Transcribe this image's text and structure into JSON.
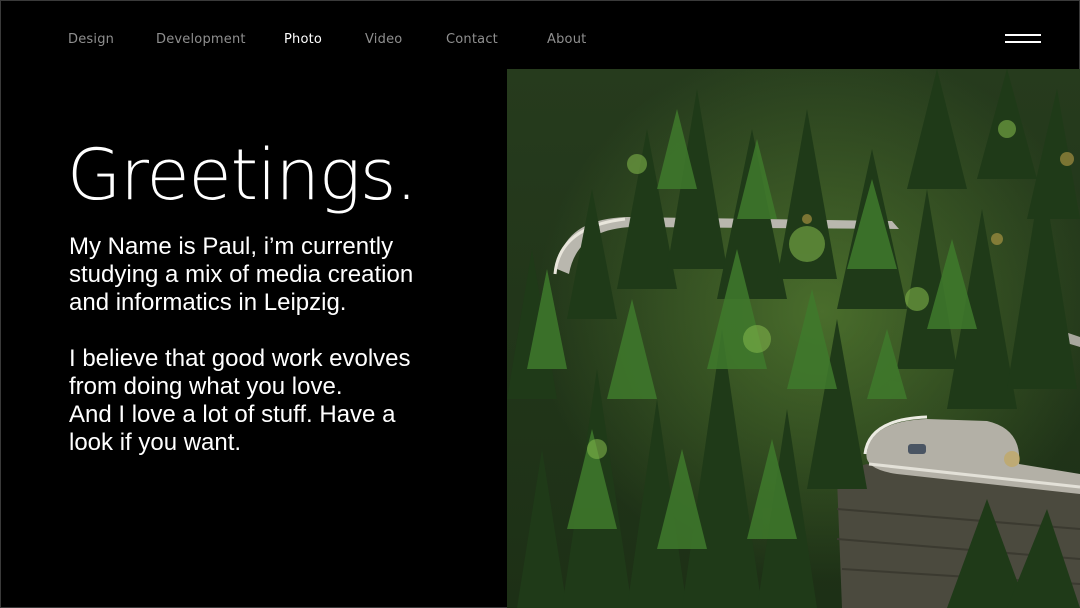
{
  "nav": {
    "items": [
      {
        "label": "Design",
        "active": false
      },
      {
        "label": "Development",
        "active": false
      },
      {
        "label": "Photo",
        "active": true
      },
      {
        "label": "Video",
        "active": false
      },
      {
        "label": "Contact",
        "active": false
      },
      {
        "label": "About",
        "active": false
      }
    ],
    "menu_icon": "hamburger-menu-icon"
  },
  "hero": {
    "headline": "Greetings.",
    "paragraph_1": "My Name is Paul, i’m currently\nstudying a mix of media creation\nand informatics in Leipzig.",
    "paragraph_2": "I believe that good work evolves\nfrom doing what you love.\nAnd I love a lot of stuff. Have a\nlook if you want."
  },
  "colors": {
    "background": "#000000",
    "text": "#ffffff",
    "nav_inactive": "#8f8f8f"
  }
}
